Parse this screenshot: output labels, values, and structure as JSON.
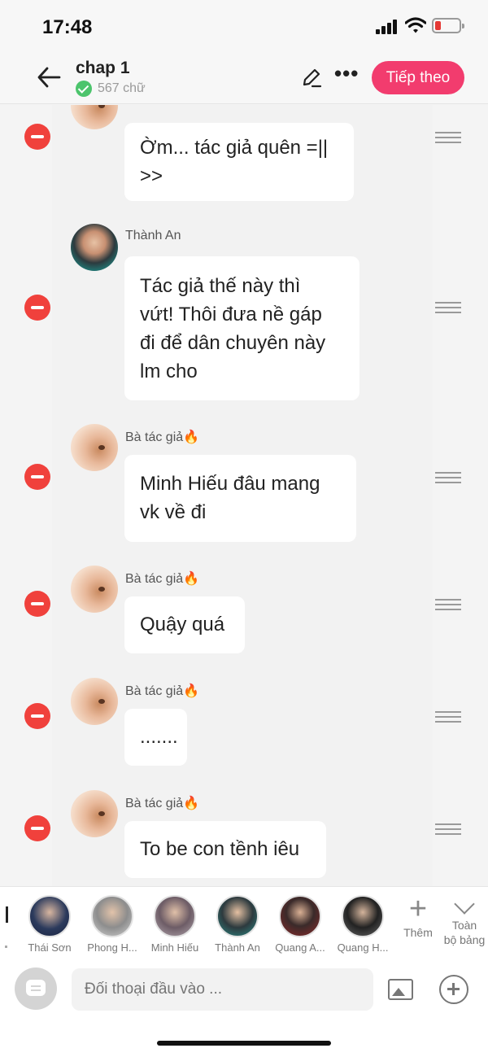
{
  "status": {
    "time": "17:48"
  },
  "header": {
    "title": "chap 1",
    "word_count": "567 chữ",
    "next_label": "Tiếp theo",
    "accent": "#f23c6e"
  },
  "messages": [
    {
      "name": "",
      "lines": [
        "Ờm... tác giả quên =||",
        ">>"
      ],
      "avatar": "author"
    },
    {
      "name": "Thành An",
      "lines": [
        "Tác giả thế này thì",
        "vứt! Thôi đưa nề gáp",
        "đi để dân chuyên này",
        "lm cho"
      ],
      "avatar": "an"
    },
    {
      "name": "Bà tác giả🔥",
      "lines": [
        "Minh Hiếu đâu mang",
        "vk về đi"
      ],
      "avatar": "author"
    },
    {
      "name": "Bà tác giả🔥",
      "lines": [
        "Quậy quá"
      ],
      "avatar": "author"
    },
    {
      "name": "Bà tác giả🔥",
      "lines": [
        "......."
      ],
      "avatar": "author"
    },
    {
      "name": "Bà tác giả🔥",
      "lines": [
        "To be con tềnh iêu"
      ],
      "avatar": "author"
    }
  ],
  "characters": [
    {
      "name": "Thái Sơn",
      "color": "#2b3a5c"
    },
    {
      "name": "Phong H...",
      "color": "#b8b8b8"
    },
    {
      "name": "Minh Hiếu",
      "color": "#9a8f95"
    },
    {
      "name": "Thành An",
      "color": "#2c8a86"
    },
    {
      "name": "Quang A...",
      "color": "#8a2a2a"
    },
    {
      "name": "Quang H...",
      "color": "#3a3a3a"
    }
  ],
  "strip": {
    "more_label": "Thêm",
    "whole_label_1": "Toàn",
    "whole_label_2": "bộ bảng"
  },
  "input": {
    "placeholder": "Đối thoại đầu vào ..."
  },
  "colors": {
    "delete": "#f0413c"
  }
}
